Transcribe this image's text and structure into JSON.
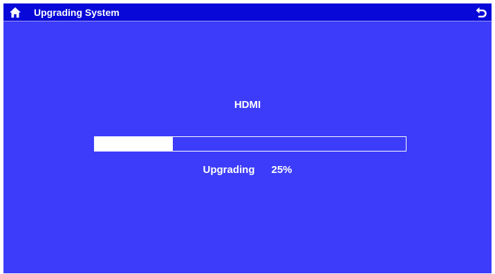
{
  "header": {
    "title": "Upgrading System",
    "home_icon": "home-icon",
    "back_icon": "back-arrow-icon"
  },
  "main": {
    "source_label": "HDMI",
    "progress_percent": 25,
    "status_label": "Upgrading",
    "percent_text": "25%"
  },
  "colors": {
    "background": "#3c3cfa",
    "header_background": "#0808d8",
    "text": "#ffffff",
    "progress_fill": "#ffffff"
  }
}
